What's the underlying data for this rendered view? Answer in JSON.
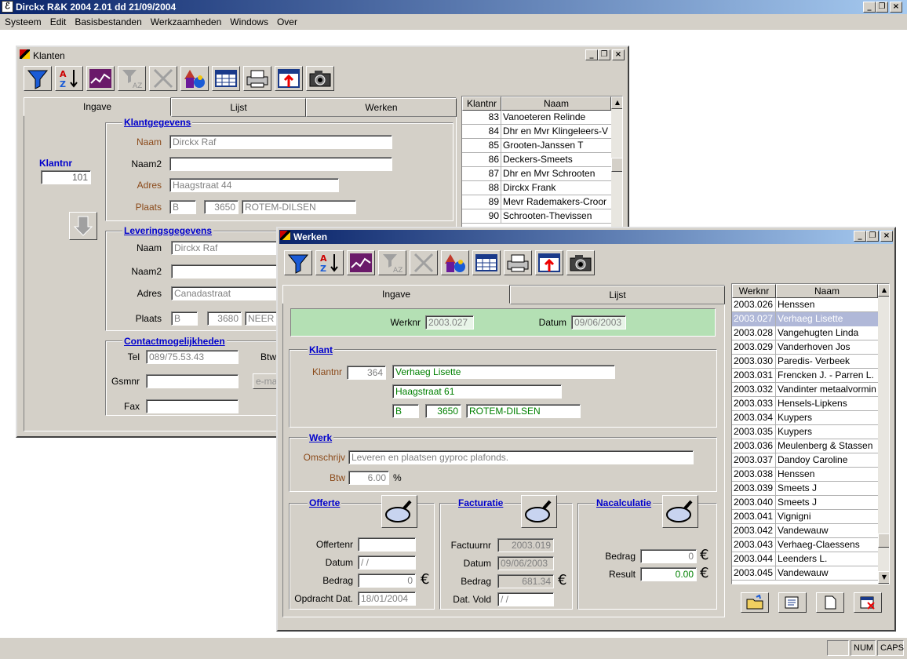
{
  "app": {
    "title": "Dirckx R&K 2004 2.01 dd 21/09/2004",
    "minimize": "_",
    "restore": "❐",
    "close": "×",
    "menu": [
      "Systeem",
      "Edit",
      "Basisbestanden",
      "Werkzaamheden",
      "Windows",
      "Over"
    ],
    "status": {
      "num": "NUM",
      "caps": "CAPS"
    }
  },
  "klanten": {
    "title": "Klanten",
    "tabs": [
      "Ingave",
      "Lijst",
      "Werken"
    ],
    "klantnr_label": "Klantnr",
    "klantnr": "101",
    "klantgegevens": {
      "title": "Klantgegevens",
      "naam_label": "Naam",
      "naam": "Dirckx Raf",
      "naam2_label": "Naam2",
      "naam2": "",
      "adres_label": "Adres",
      "adres": "Haagstraat 44",
      "plaats_label": "Plaats",
      "land": "B",
      "postcode": "3650",
      "gemeente": "ROTEM-DILSEN"
    },
    "levering": {
      "title": "Leveringsgegevens",
      "naam_label": "Naam",
      "naam": "Dirckx Raf",
      "naam2_label": "Naam2",
      "naam2": "",
      "adres_label": "Adres",
      "adres": "Canadastraat",
      "plaats_label": "Plaats",
      "land": "B",
      "postcode": "3680",
      "gemeente": "NEER"
    },
    "contact": {
      "title": "Contactmogelijkheden",
      "tel_label": "Tel",
      "tel": "089/75.53.43",
      "btw_label": "Btw",
      "gsm_label": "Gsmnr",
      "gsm": "",
      "email_btn": "e-ma",
      "fax_label": "Fax",
      "fax": ""
    },
    "grid": {
      "headers": [
        "Klantnr",
        "Naam"
      ],
      "rows": [
        {
          "nr": "83",
          "naam": "Vanoeteren Relinde"
        },
        {
          "nr": "84",
          "naam": "Dhr en Mvr Klingeleers-V"
        },
        {
          "nr": "85",
          "naam": "Grooten-Janssen T"
        },
        {
          "nr": "86",
          "naam": "Deckers-Smeets"
        },
        {
          "nr": "87",
          "naam": "Dhr en Mvr Schrooten"
        },
        {
          "nr": "88",
          "naam": "Dirckx Frank"
        },
        {
          "nr": "89",
          "naam": "Mevr Rademakers-Croor"
        },
        {
          "nr": "90",
          "naam": "Schrooten-Thevissen"
        }
      ]
    }
  },
  "werken": {
    "title": "Werken",
    "tabs": [
      "Ingave",
      "Lijst"
    ],
    "werknr_label": "Werknr",
    "werknr": "2003.027",
    "datum_label": "Datum",
    "datum": "09/06/2003",
    "klant": {
      "title": "Klant",
      "klantnr_label": "Klantnr",
      "klantnr": "364",
      "naam": "Verhaeg Lisette",
      "adres": "Haagstraat 61",
      "land": "B",
      "postcode": "3650",
      "gemeente": "ROTEM-DILSEN"
    },
    "werk": {
      "title": "Werk",
      "omschrijving_label": "Omschrijv",
      "omschrijving": "Leveren en plaatsen gyproc plafonds.",
      "btw_label": "Btw",
      "btw": "6.00",
      "pct": "%"
    },
    "offerte": {
      "title": "Offerte",
      "nr_label": "Offertenr",
      "nr": "",
      "datum_label": "Datum",
      "datum": " / /",
      "bedrag_label": "Bedrag",
      "bedrag": "0",
      "opdracht_label": "Opdracht Dat.",
      "opdracht": "18/01/2004",
      "euro": "€"
    },
    "facturatie": {
      "title": "Facturatie",
      "nr_label": "Factuurnr",
      "nr": "2003.019",
      "datum_label": "Datum",
      "datum": "09/06/2003",
      "bedrag_label": "Bedrag",
      "bedrag": "681.34",
      "vold_label": "Dat. Vold",
      "vold": " / /",
      "euro": "€"
    },
    "nacalculatie": {
      "title": "Nacalculatie",
      "bedrag_label": "Bedrag",
      "bedrag": "0",
      "result_label": "Result",
      "result": "0.00",
      "euro": "€"
    },
    "grid": {
      "headers": [
        "Werknr",
        "Naam"
      ],
      "selected": 1,
      "rows": [
        {
          "nr": "2003.026",
          "naam": "Henssen"
        },
        {
          "nr": "2003.027",
          "naam": "Verhaeg Lisette"
        },
        {
          "nr": "2003.028",
          "naam": "Vangehugten Linda"
        },
        {
          "nr": "2003.029",
          "naam": "Vanderhoven Jos"
        },
        {
          "nr": "2003.030",
          "naam": "Paredis- Verbeek"
        },
        {
          "nr": "2003.031",
          "naam": "Frencken J. - Parren L."
        },
        {
          "nr": "2003.032",
          "naam": "Vandinter metaalvormin"
        },
        {
          "nr": "2003.033",
          "naam": "Hensels-Lipkens"
        },
        {
          "nr": "2003.034",
          "naam": "Kuypers"
        },
        {
          "nr": "2003.035",
          "naam": "Kuypers"
        },
        {
          "nr": "2003.036",
          "naam": "Meulenberg & Stassen"
        },
        {
          "nr": "2003.037",
          "naam": "Dandoy Caroline"
        },
        {
          "nr": "2003.038",
          "naam": "Henssen"
        },
        {
          "nr": "2003.039",
          "naam": "Smeets J"
        },
        {
          "nr": "2003.040",
          "naam": "Smeets J"
        },
        {
          "nr": "2003.041",
          "naam": "Vignigni"
        },
        {
          "nr": "2003.042",
          "naam": "Vandewauw"
        },
        {
          "nr": "2003.043",
          "naam": "Verhaeg-Claessens"
        },
        {
          "nr": "2003.044",
          "naam": "Leenders L."
        },
        {
          "nr": "2003.045",
          "naam": "Vandewauw"
        }
      ]
    }
  }
}
